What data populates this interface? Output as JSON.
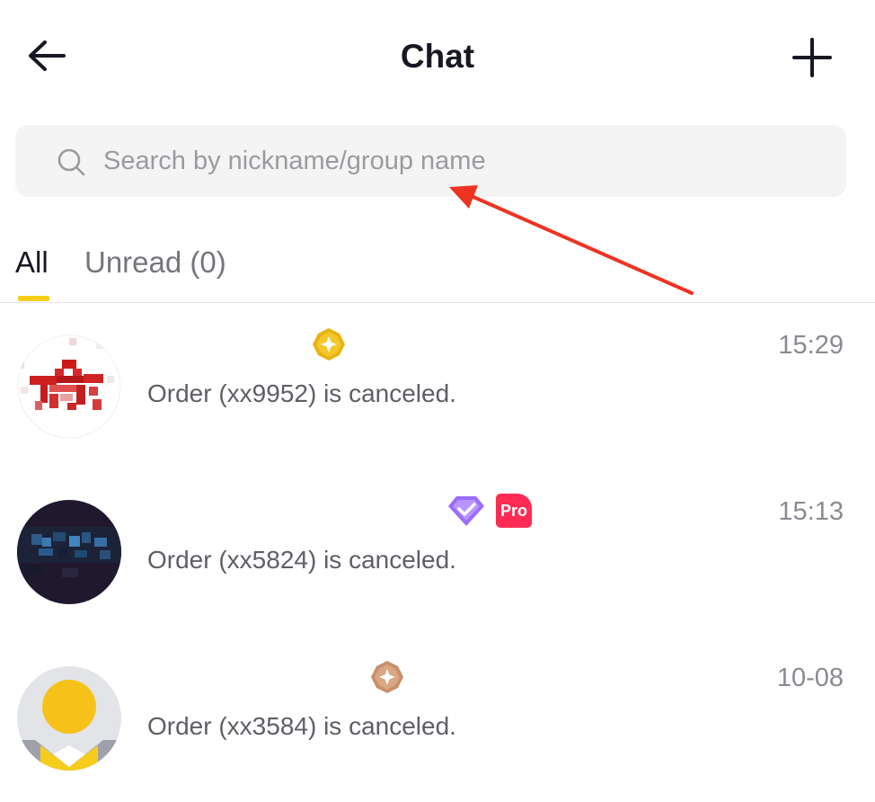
{
  "header": {
    "title": "Chat",
    "back_icon": "arrow-left-icon",
    "add_icon": "plus-icon"
  },
  "search": {
    "placeholder": "Search by nickname/group name",
    "icon": "search-icon"
  },
  "tabs": [
    {
      "label": "All",
      "active": true
    },
    {
      "label": "Unread (0)",
      "active": false
    }
  ],
  "conversations": [
    {
      "message": "Order (xx9952) is canceled.",
      "time": "15:29",
      "badges": [
        "gold-tier-badge-icon"
      ]
    },
    {
      "message": "Order (xx5824) is canceled.",
      "time": "15:13",
      "badges": [
        "purple-verified-badge-icon",
        "pro-badge-icon"
      ]
    },
    {
      "message": "Order (xx3584) is canceled.",
      "time": "10-08",
      "badges": [
        "bronze-tier-badge-icon"
      ]
    }
  ],
  "pro_badge_label": "Pro",
  "colors": {
    "accent_yellow": "#f6cd1b",
    "annotation_red": "#ee3322",
    "pro_pink": "#fe2c55",
    "verified_purple": "#9b6cff",
    "gold": "#e9b30f",
    "bronze": "#c98f6a"
  }
}
